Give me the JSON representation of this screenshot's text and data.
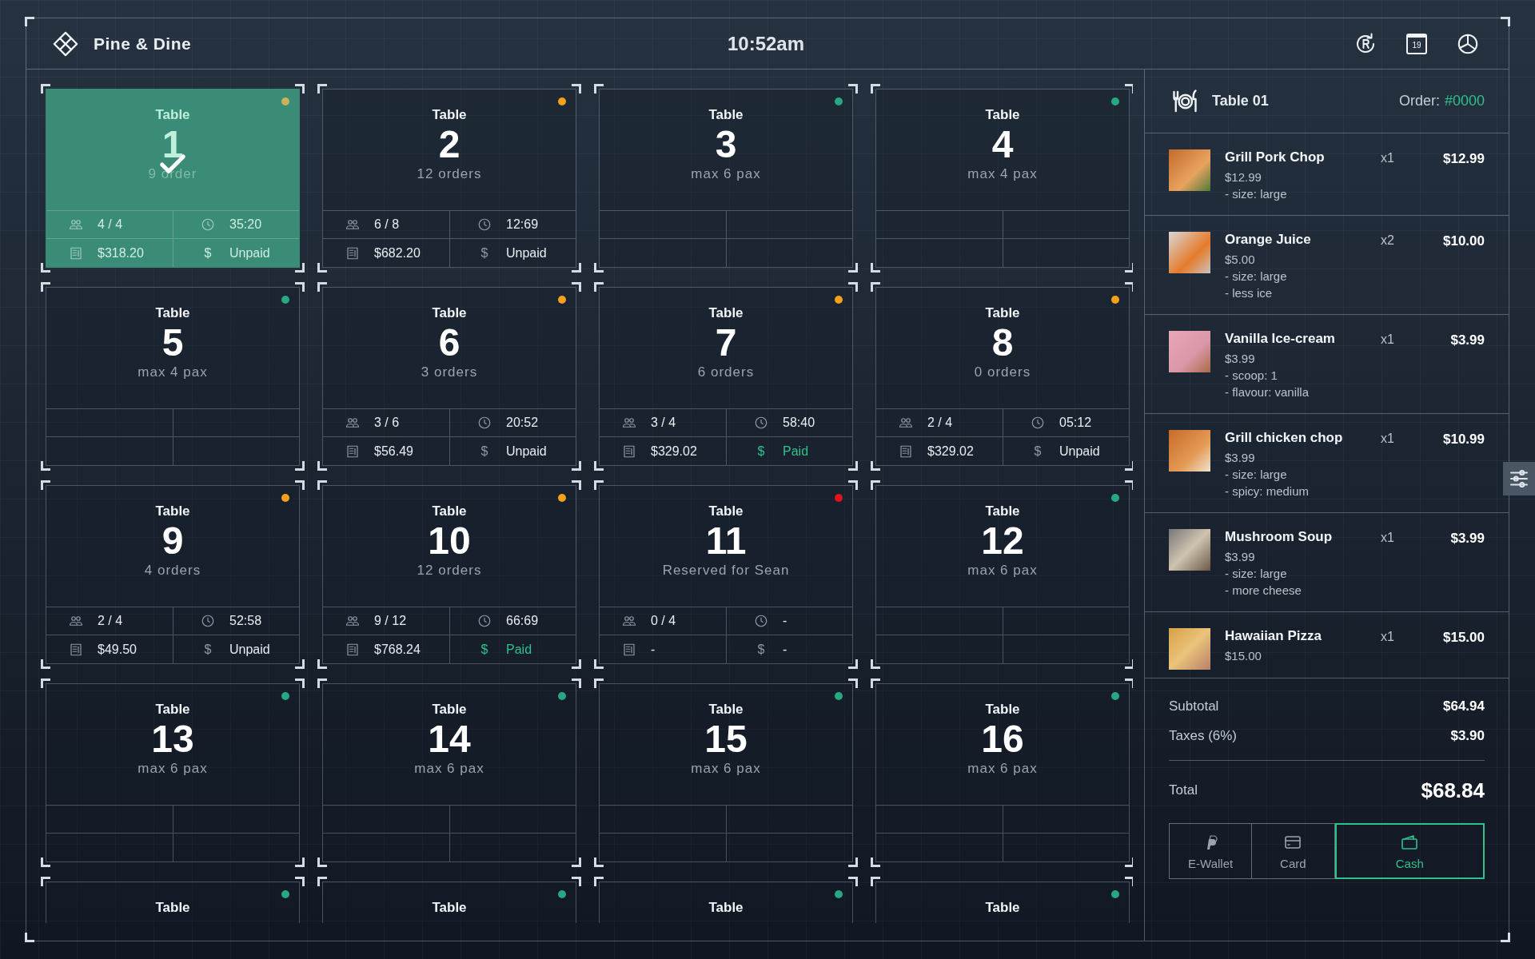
{
  "header": {
    "brand": "Pine & Dine",
    "time": "10:52am",
    "calendar_day": "19"
  },
  "tables": [
    {
      "kind": "occupied",
      "label": "Table",
      "number": "1",
      "subtitle": "9 order",
      "color": "#c9b35a",
      "selected": true,
      "guests": "4 / 4",
      "time": "35:20",
      "amount": "$318.20",
      "currency": "$",
      "payment": "Unpaid",
      "paid": false
    },
    {
      "kind": "occupied",
      "label": "Table",
      "number": "2",
      "subtitle": "12 orders",
      "color": "#f5a01a",
      "selected": false,
      "guests": "6 / 8",
      "time": "12:69",
      "amount": "$682.20",
      "currency": "$",
      "payment": "Unpaid",
      "paid": false
    },
    {
      "kind": "free",
      "label": "Table",
      "number": "3",
      "subtitle": "max 6 pax",
      "color": "#27a883",
      "selected": false
    },
    {
      "kind": "free",
      "label": "Table",
      "number": "4",
      "subtitle": "max 4 pax",
      "color": "#27a883",
      "selected": false
    },
    {
      "kind": "free",
      "label": "Table",
      "number": "5",
      "subtitle": "max 4 pax",
      "color": "#27a883",
      "selected": false
    },
    {
      "kind": "occupied",
      "label": "Table",
      "number": "6",
      "subtitle": "3 orders",
      "color": "#f5a01a",
      "selected": false,
      "guests": "3 / 6",
      "time": "20:52",
      "amount": "$56.49",
      "currency": "$",
      "payment": "Unpaid",
      "paid": false
    },
    {
      "kind": "occupied",
      "label": "Table",
      "number": "7",
      "subtitle": "6 orders",
      "color": "#f5a01a",
      "selected": false,
      "guests": "3 / 4",
      "time": "58:40",
      "amount": "$329.02",
      "currency": "$",
      "payment": "Paid",
      "paid": true
    },
    {
      "kind": "occupied",
      "label": "Table",
      "number": "8",
      "subtitle": "0 orders",
      "color": "#f5a01a",
      "selected": false,
      "guests": "2 / 4",
      "time": "05:12",
      "amount": "$329.02",
      "currency": "$",
      "payment": "Unpaid",
      "paid": false
    },
    {
      "kind": "occupied",
      "label": "Table",
      "number": "9",
      "subtitle": "4 orders",
      "color": "#f5a01a",
      "selected": false,
      "guests": "2 / 4",
      "time": "52:58",
      "amount": "$49.50",
      "currency": "$",
      "payment": "Unpaid",
      "paid": false
    },
    {
      "kind": "occupied",
      "label": "Table",
      "number": "10",
      "subtitle": "12 orders",
      "color": "#f5a01a",
      "selected": false,
      "guests": "9 / 12",
      "time": "66:69",
      "amount": "$768.24",
      "currency": "$",
      "payment": "Paid",
      "paid": true
    },
    {
      "kind": "occupied",
      "label": "Table",
      "number": "11",
      "subtitle": "Reserved for Sean",
      "color": "#e0141a",
      "selected": false,
      "guests": "0 / 4",
      "time": "-",
      "amount": "-",
      "currency": "$",
      "payment": "-",
      "paid": false
    },
    {
      "kind": "free",
      "label": "Table",
      "number": "12",
      "subtitle": "max 6 pax",
      "color": "#27a883",
      "selected": false
    },
    {
      "kind": "free",
      "label": "Table",
      "number": "13",
      "subtitle": "max 6 pax",
      "color": "#27a883",
      "selected": false
    },
    {
      "kind": "free",
      "label": "Table",
      "number": "14",
      "subtitle": "max 6 pax",
      "color": "#27a883",
      "selected": false
    },
    {
      "kind": "free",
      "label": "Table",
      "number": "15",
      "subtitle": "max 6 pax",
      "color": "#27a883",
      "selected": false
    },
    {
      "kind": "free",
      "label": "Table",
      "number": "16",
      "subtitle": "max 6 pax",
      "color": "#27a883",
      "selected": false
    },
    {
      "kind": "partial",
      "label": "Table",
      "color": "#27a883",
      "selected": false
    },
    {
      "kind": "partial",
      "label": "Table",
      "color": "#27a883",
      "selected": false
    },
    {
      "kind": "partial",
      "label": "Table",
      "color": "#27a883",
      "selected": false
    },
    {
      "kind": "partial",
      "label": "Table",
      "color": "#27a883",
      "selected": false
    }
  ],
  "order": {
    "table": "Table 01",
    "order_label": "Order:",
    "order_number": "#0000",
    "items": [
      {
        "name": "Grill Pork Chop",
        "quantity": "x1",
        "total": "$12.99",
        "price": "$12.99",
        "options": [
          "- size: large"
        ]
      },
      {
        "name": "Orange Juice",
        "quantity": "x2",
        "total": "$10.00",
        "price": "$5.00",
        "options": [
          "- size: large",
          "- less ice"
        ]
      },
      {
        "name": "Vanilla Ice-cream",
        "quantity": "x1",
        "total": "$3.99",
        "price": "$3.99",
        "options": [
          "- scoop: 1",
          "- flavour: vanilla"
        ]
      },
      {
        "name": "Grill chicken chop",
        "quantity": "x1",
        "total": "$10.99",
        "price": "$3.99",
        "options": [
          "- size: large",
          "- spicy: medium"
        ]
      },
      {
        "name": "Mushroom Soup",
        "quantity": "x1",
        "total": "$3.99",
        "price": "$3.99",
        "options": [
          "- size: large",
          "- more cheese"
        ]
      },
      {
        "name": "Hawaiian Pizza",
        "quantity": "x1",
        "total": "$15.00",
        "price": "$15.00"
      }
    ],
    "subtotal_label": "Subtotal",
    "subtotal": "$64.94",
    "taxes_label": "Taxes (6%)",
    "taxes": "$3.90",
    "total_label": "Total",
    "total": "$68.84",
    "payment_methods": [
      {
        "kind": "wallet",
        "label": "E-Wallet",
        "selected": false
      },
      {
        "kind": "card",
        "label": "Card",
        "selected": false
      },
      {
        "kind": "cash",
        "label": "Cash",
        "selected": true
      }
    ]
  }
}
